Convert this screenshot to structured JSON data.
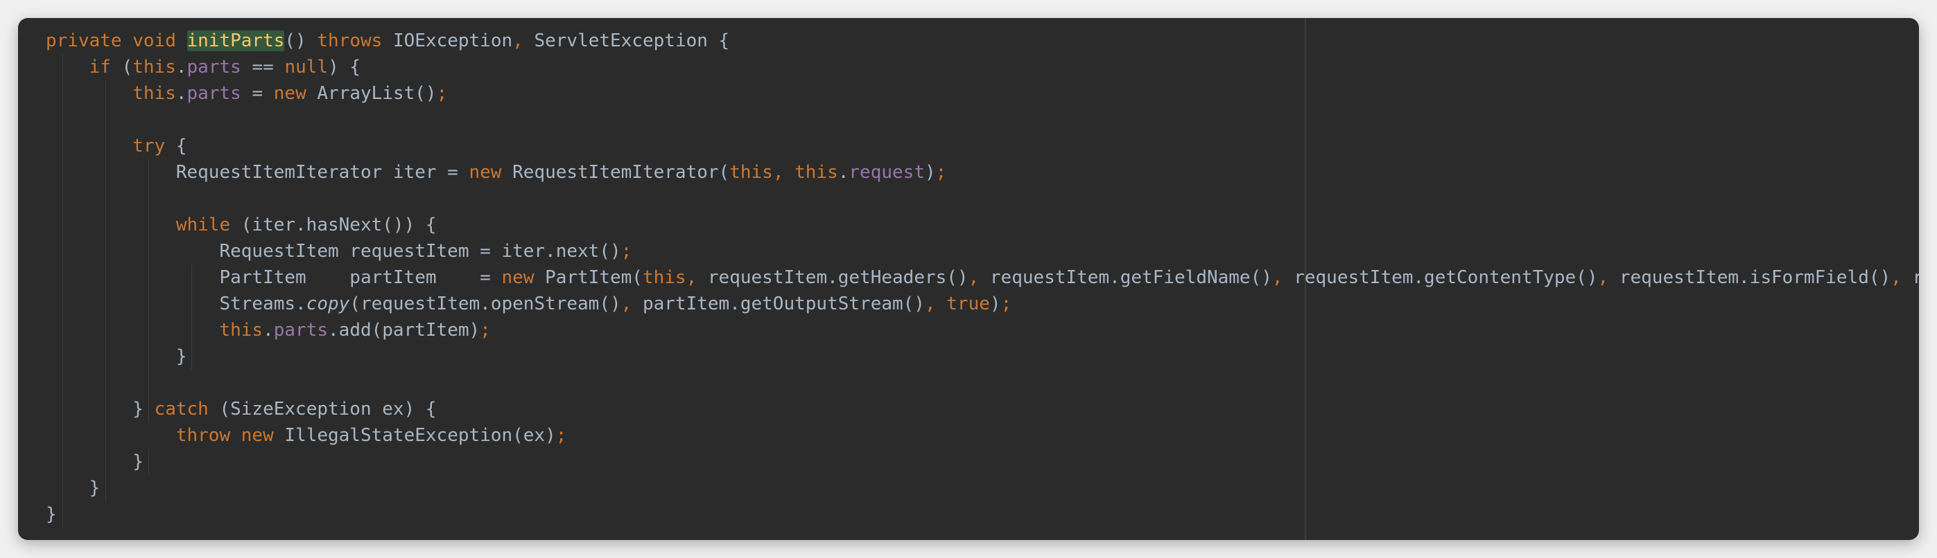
{
  "editor": {
    "lines": [
      [
        {
          "t": "private ",
          "c": "kw"
        },
        {
          "t": "void ",
          "c": "kw"
        },
        {
          "t": "initParts",
          "c": "hl"
        },
        {
          "t": "() ",
          "c": ""
        },
        {
          "t": "throws ",
          "c": "kw"
        },
        {
          "t": "IOException",
          "c": ""
        },
        {
          "t": ", ",
          "c": "punc"
        },
        {
          "t": "ServletException {",
          "c": ""
        }
      ],
      [
        {
          "t": "    ",
          "c": ""
        },
        {
          "t": "if ",
          "c": "kw"
        },
        {
          "t": "(",
          "c": ""
        },
        {
          "t": "this",
          "c": "kw"
        },
        {
          "t": ".",
          "c": ""
        },
        {
          "t": "parts",
          "c": "field"
        },
        {
          "t": " == ",
          "c": ""
        },
        {
          "t": "null",
          "c": "kw"
        },
        {
          "t": ") {",
          "c": ""
        }
      ],
      [
        {
          "t": "        ",
          "c": ""
        },
        {
          "t": "this",
          "c": "kw"
        },
        {
          "t": ".",
          "c": ""
        },
        {
          "t": "parts",
          "c": "field"
        },
        {
          "t": " = ",
          "c": ""
        },
        {
          "t": "new ",
          "c": "kw"
        },
        {
          "t": "ArrayList()",
          "c": ""
        },
        {
          "t": ";",
          "c": "punc"
        }
      ],
      [],
      [
        {
          "t": "        ",
          "c": ""
        },
        {
          "t": "try ",
          "c": "kw"
        },
        {
          "t": "{",
          "c": ""
        }
      ],
      [
        {
          "t": "            RequestItemIterator iter = ",
          "c": ""
        },
        {
          "t": "new ",
          "c": "kw"
        },
        {
          "t": "RequestItemIterator(",
          "c": ""
        },
        {
          "t": "this",
          "c": "kw"
        },
        {
          "t": ", ",
          "c": "punc"
        },
        {
          "t": "this",
          "c": "kw"
        },
        {
          "t": ".",
          "c": ""
        },
        {
          "t": "request",
          "c": "field"
        },
        {
          "t": ")",
          "c": ""
        },
        {
          "t": ";",
          "c": "punc"
        }
      ],
      [],
      [
        {
          "t": "            ",
          "c": ""
        },
        {
          "t": "while ",
          "c": "kw"
        },
        {
          "t": "(iter.hasNext()) {",
          "c": ""
        }
      ],
      [
        {
          "t": "                RequestItem requestItem = iter.next()",
          "c": ""
        },
        {
          "t": ";",
          "c": "punc"
        }
      ],
      [
        {
          "t": "                PartItem    partItem    = ",
          "c": ""
        },
        {
          "t": "new ",
          "c": "kw"
        },
        {
          "t": "PartItem(",
          "c": ""
        },
        {
          "t": "this",
          "c": "kw"
        },
        {
          "t": ", ",
          "c": "punc"
        },
        {
          "t": "requestItem.getHeaders()",
          "c": ""
        },
        {
          "t": ", ",
          "c": "punc"
        },
        {
          "t": "requestItem.getFieldName()",
          "c": ""
        },
        {
          "t": ", ",
          "c": "punc"
        },
        {
          "t": "requestItem.getContentType()",
          "c": ""
        },
        {
          "t": ", ",
          "c": "punc"
        },
        {
          "t": "requestItem.isFormField()",
          "c": ""
        },
        {
          "t": ", ",
          "c": "punc"
        },
        {
          "t": "r",
          "c": ""
        }
      ],
      [
        {
          "t": "                Streams.",
          "c": ""
        },
        {
          "t": "copy",
          "c": "italic"
        },
        {
          "t": "(requestItem.openStream()",
          "c": ""
        },
        {
          "t": ", ",
          "c": "punc"
        },
        {
          "t": "partItem.getOutputStream()",
          "c": ""
        },
        {
          "t": ", ",
          "c": "punc"
        },
        {
          "t": "true",
          "c": "kw"
        },
        {
          "t": ")",
          "c": ""
        },
        {
          "t": ";",
          "c": "punc"
        }
      ],
      [
        {
          "t": "                ",
          "c": ""
        },
        {
          "t": "this",
          "c": "kw"
        },
        {
          "t": ".",
          "c": ""
        },
        {
          "t": "parts",
          "c": "field"
        },
        {
          "t": ".add(partItem)",
          "c": ""
        },
        {
          "t": ";",
          "c": "punc"
        }
      ],
      [
        {
          "t": "            }",
          "c": ""
        }
      ],
      [],
      [
        {
          "t": "        } ",
          "c": ""
        },
        {
          "t": "catch ",
          "c": "kw"
        },
        {
          "t": "(SizeException ex) {",
          "c": ""
        }
      ],
      [
        {
          "t": "            ",
          "c": ""
        },
        {
          "t": "throw ",
          "c": "kw"
        },
        {
          "t": "new ",
          "c": "kw"
        },
        {
          "t": "IllegalStateException(ex)",
          "c": ""
        },
        {
          "t": ";",
          "c": "punc"
        }
      ],
      [
        {
          "t": "        }",
          "c": ""
        }
      ],
      [
        {
          "t": "    }",
          "c": ""
        }
      ],
      [
        {
          "t": "}",
          "c": ""
        }
      ]
    ]
  }
}
